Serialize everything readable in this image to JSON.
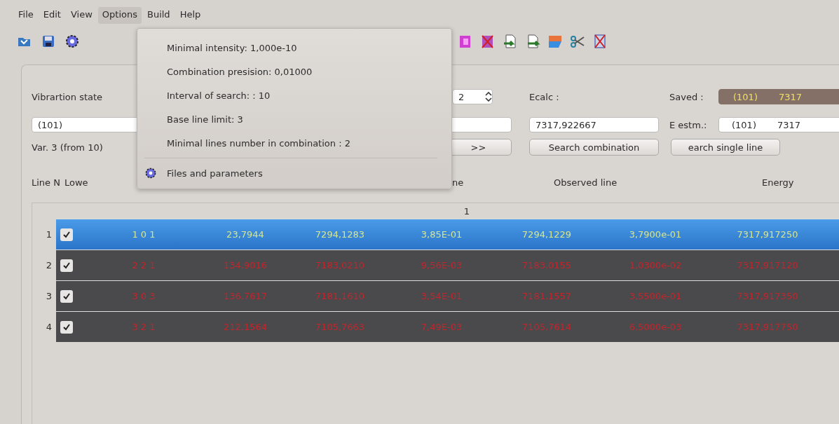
{
  "menubar": [
    {
      "label": "File",
      "selected": false
    },
    {
      "label": "Edit",
      "selected": false
    },
    {
      "label": "View",
      "selected": false
    },
    {
      "label": "Options",
      "selected": true
    },
    {
      "label": "Build",
      "selected": false
    },
    {
      "label": "Help",
      "selected": false
    }
  ],
  "options_menu": {
    "items": [
      {
        "kind": "text",
        "label": "Minimal intensity:  1,000e-10"
      },
      {
        "kind": "text",
        "label": "Combination presision:  0,01000"
      },
      {
        "kind": "text",
        "label": "Interval of search:  :  10"
      },
      {
        "kind": "text",
        "label": "Base line limit:  3"
      },
      {
        "kind": "text",
        "label": "Minimal lines number in combination :  2"
      },
      {
        "kind": "separator"
      },
      {
        "kind": "icon",
        "label": "Files and parameters"
      }
    ]
  },
  "controls": {
    "vibration_label": "Vibrartion state",
    "spin_value": "2",
    "ecalc_label": "Ecalc :",
    "saved_label": "Saved :",
    "saved_state": "(101)",
    "saved_value": "7317",
    "state_field": "(101)",
    "ecalc_value": "7317,922667",
    "estm_label": "E estm.:",
    "estm_state": "(101)",
    "estm_value": "7317",
    "variant": "Var. 3 (from 10)",
    "next_button": ">>",
    "search_combination": "Search combination",
    "search_single": "earch single line"
  },
  "headers": [
    "Line N",
    "Lowe",
    "ne",
    "Observed line",
    "Energy"
  ],
  "table": {
    "column_header": "1",
    "rows": [
      {
        "n": "1",
        "checked": true,
        "selected": true,
        "cells": [
          "1  0  1",
          "23,7944",
          "7294,1283",
          "3,85E-01",
          "7294,1229",
          "3,7900e-01",
          "7317,917250"
        ]
      },
      {
        "n": "2",
        "checked": true,
        "selected": false,
        "cells": [
          "2  2  1",
          "134,9016",
          "7183,0210",
          "9,56E-03",
          "7183,0155",
          "1,0300e-02",
          "7317,917120"
        ]
      },
      {
        "n": "3",
        "checked": true,
        "selected": false,
        "cells": [
          "3  0  3",
          "136,7617",
          "7181,1610",
          "3,54E-01",
          "7181,1557",
          "3,5500e-01",
          "7317,917350"
        ]
      },
      {
        "n": "4",
        "checked": true,
        "selected": false,
        "cells": [
          "3  2  1",
          "212,1564",
          "7105,7663",
          "7,49E-03",
          "7105,7614",
          "6,5000e-03",
          "7317,917750"
        ]
      }
    ]
  }
}
